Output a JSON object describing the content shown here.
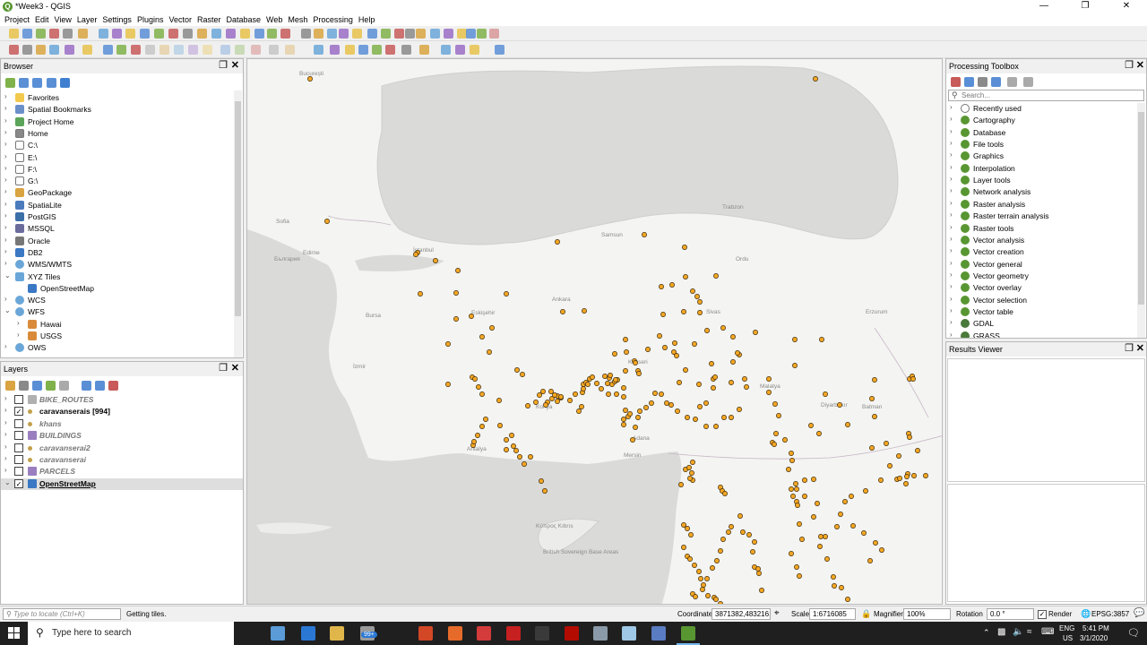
{
  "window": {
    "title": "*Week3 - QGIS",
    "app_icon": "qgis-icon",
    "controls": [
      "minimize",
      "restore",
      "close"
    ]
  },
  "menu": [
    "Project",
    "Edit",
    "View",
    "Layer",
    "Settings",
    "Plugins",
    "Vector",
    "Raster",
    "Database",
    "Web",
    "Mesh",
    "Processing",
    "Help"
  ],
  "browser": {
    "title": "Browser",
    "items": [
      {
        "label": "Favorites",
        "icon": "star-icon"
      },
      {
        "label": "Spatial Bookmarks",
        "icon": "bookmark-icon"
      },
      {
        "label": "Project Home",
        "icon": "folder-icon"
      },
      {
        "label": "Home",
        "icon": "home-icon"
      },
      {
        "label": "C:\\",
        "icon": "drive-icon"
      },
      {
        "label": "E:\\",
        "icon": "drive-icon"
      },
      {
        "label": "F:\\",
        "icon": "drive-icon"
      },
      {
        "label": "G:\\",
        "icon": "drive-icon"
      },
      {
        "label": "GeoPackage",
        "icon": "geopackage-icon"
      },
      {
        "label": "SpatiaLite",
        "icon": "spatialite-icon"
      },
      {
        "label": "PostGIS",
        "icon": "postgis-icon"
      },
      {
        "label": "MSSQL",
        "icon": "mssql-icon"
      },
      {
        "label": "Oracle",
        "icon": "oracle-icon"
      },
      {
        "label": "DB2",
        "icon": "db2-icon"
      },
      {
        "label": "WMS/WMTS",
        "icon": "globe-icon"
      },
      {
        "label": "XYZ Tiles",
        "icon": "xyz-tiles-icon"
      },
      {
        "label": "OpenStreetMap",
        "icon": "tile-layer-icon"
      },
      {
        "label": "WCS",
        "icon": "globe-icon"
      },
      {
        "label": "WFS",
        "icon": "globe-icon"
      },
      {
        "label": "Hawai",
        "icon": "wfs-layer-icon"
      },
      {
        "label": "USGS",
        "icon": "wfs-layer-icon"
      },
      {
        "label": "OWS",
        "icon": "globe-icon"
      }
    ]
  },
  "layers": {
    "title": "Layers",
    "items": [
      {
        "label": "BIKE_ROUTES",
        "checked": false,
        "icon": "line-layer-icon"
      },
      {
        "label": "caravanserais [994]",
        "checked": true,
        "icon": "point-layer-icon"
      },
      {
        "label": "khans",
        "checked": false,
        "icon": "point-layer-icon"
      },
      {
        "label": "BUILDINGS",
        "checked": false,
        "icon": "polygon-layer-icon"
      },
      {
        "label": "caravanserai2",
        "checked": false,
        "icon": "point-layer-icon"
      },
      {
        "label": "caravanserai",
        "checked": false,
        "icon": "point-layer-icon"
      },
      {
        "label": "PARCELS",
        "checked": false,
        "icon": "polygon-layer-icon"
      },
      {
        "label": "OpenStreetMap",
        "checked": true,
        "icon": "tile-layer-icon"
      }
    ]
  },
  "toolbox": {
    "title": "Processing Toolbox",
    "search_placeholder": "Search...",
    "items": [
      "Recently used",
      "Cartography",
      "Database",
      "File tools",
      "Graphics",
      "Interpolation",
      "Layer tools",
      "Network analysis",
      "Raster analysis",
      "Raster terrain analysis",
      "Raster tools",
      "Vector analysis",
      "Vector creation",
      "Vector general",
      "Vector geometry",
      "Vector overlay",
      "Vector selection",
      "Vector table",
      "GDAL",
      "GRASS"
    ]
  },
  "results": {
    "title": "Results Viewer"
  },
  "map": {
    "labels": [
      {
        "text": "București"
      },
      {
        "text": "Sofia"
      },
      {
        "text": "България"
      },
      {
        "text": "Edirne"
      },
      {
        "text": "İstanbul"
      },
      {
        "text": "Bursa"
      },
      {
        "text": "Eskişehir"
      },
      {
        "text": "Ankara"
      },
      {
        "text": "Samsun"
      },
      {
        "text": "Sivas"
      },
      {
        "text": "Konya"
      },
      {
        "text": "Kayseri"
      },
      {
        "text": "İzmir"
      },
      {
        "text": "Antalya"
      },
      {
        "text": "Mersin"
      },
      {
        "text": "Adana"
      },
      {
        "text": "Malatya"
      },
      {
        "text": "Erzurum"
      },
      {
        "text": "Diyarbakır"
      },
      {
        "text": "Κύπρος Kıbrıs"
      },
      {
        "text": "British Sovereign Base Areas"
      },
      {
        "text": "Trabzon"
      },
      {
        "text": "Ordu"
      },
      {
        "text": "Batman"
      }
    ],
    "point_color": "#f5a623",
    "point_count": 994
  },
  "statusbar": {
    "locate_placeholder": "Type to locate (Ctrl+K)",
    "message": "Getting tiles.",
    "coordinate_label": "Coordinate",
    "coordinate": "3871382,4832161",
    "scale_label": "Scale",
    "scale": "1:6716085",
    "magnifier_label": "Magnifier",
    "magnifier": "100%",
    "rotation_label": "Rotation",
    "rotation": "0.0 °",
    "render_label": "Render",
    "crs": "EPSG:3857"
  },
  "taskbar": {
    "search_placeholder": "Type here to search",
    "badge": "99+",
    "lang": "ENG",
    "region": "US",
    "time": "5:41 PM",
    "date": "3/1/2020"
  }
}
